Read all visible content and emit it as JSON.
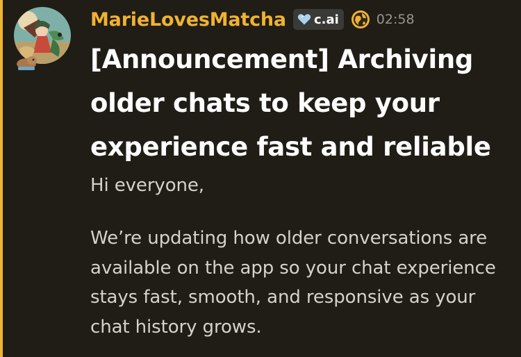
{
  "message": {
    "author": {
      "username": "MarieLovesMatcha",
      "username_color": "#f0b232",
      "avatar": "anime-character-avatar",
      "avatar_decoration": "capybara-decoration-icon"
    },
    "server_tag": {
      "icon": "heart-icon",
      "label": "c.ai"
    },
    "role_icon": "globe-icon",
    "timestamp": "02:58",
    "title": "[Announcement] Archiving older chats to keep your experience fast and reliable",
    "greeting": "Hi everyone,",
    "paragraph": "We’re updating how older conversations are available on the app so your chat experience stays fast, smooth, and responsive as your chat history grows.",
    "colors": {
      "highlight_bar": "#f0b232",
      "background": "#1f1d15",
      "title": "#fefefe",
      "body": "#d4d2cc",
      "timestamp": "#96958f"
    }
  }
}
